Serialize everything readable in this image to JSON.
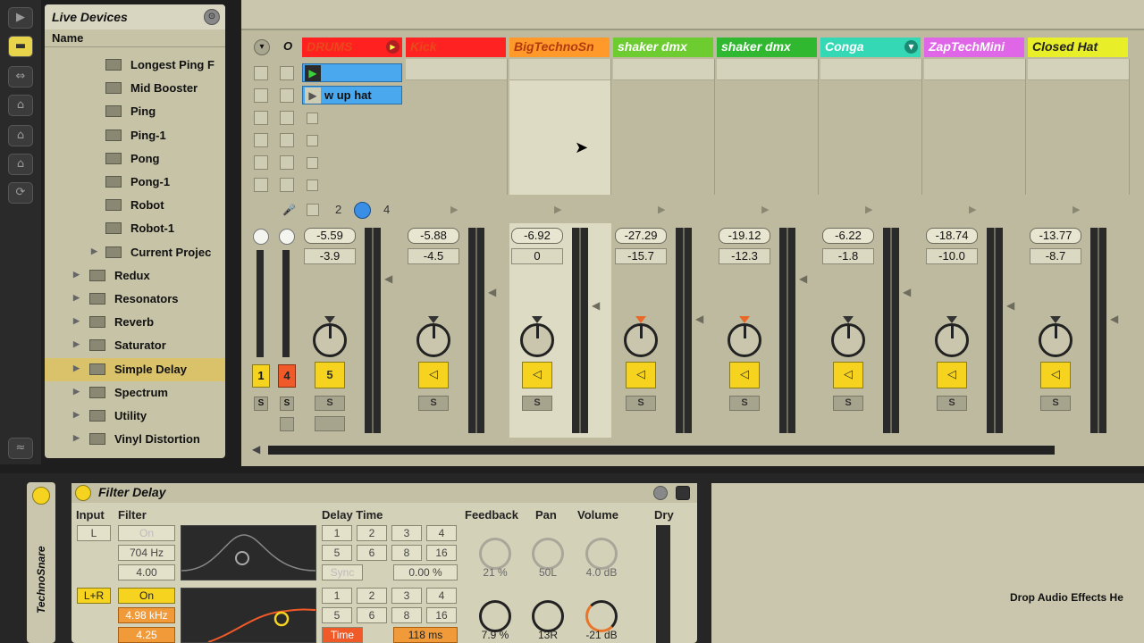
{
  "browser": {
    "title": "Live Devices",
    "hotswap_icon": "⊙",
    "column_header": "Name",
    "items": [
      {
        "label": "Longest Ping F",
        "kind": "preset"
      },
      {
        "label": "Mid Booster",
        "kind": "preset"
      },
      {
        "label": "Ping",
        "kind": "preset"
      },
      {
        "label": "Ping-1",
        "kind": "preset"
      },
      {
        "label": "Pong",
        "kind": "preset"
      },
      {
        "label": "Pong-1",
        "kind": "preset"
      },
      {
        "label": "Robot",
        "kind": "preset"
      },
      {
        "label": "Robot-1",
        "kind": "preset"
      },
      {
        "label": "Current Projec",
        "kind": "subfolder"
      },
      {
        "label": "Redux",
        "kind": "folder"
      },
      {
        "label": "Resonators",
        "kind": "folder"
      },
      {
        "label": "Reverb",
        "kind": "folder"
      },
      {
        "label": "Saturator",
        "kind": "folder"
      },
      {
        "label": "Simple Delay",
        "kind": "folder",
        "selected": true
      },
      {
        "label": "Spectrum",
        "kind": "folder"
      },
      {
        "label": "Utility",
        "kind": "folder"
      },
      {
        "label": "Vinyl Distortion",
        "kind": "folder"
      }
    ]
  },
  "session": {
    "header_buttons": {
      "fold": "▾",
      "overdub": "O"
    },
    "tracks": [
      {
        "name": "DRUMS",
        "color": "#ff2020",
        "text_color": "#e84a1a",
        "volume": "-5.59",
        "pan": "-3.9",
        "knob_mark": "dark",
        "button": "5"
      },
      {
        "name": "Kick",
        "color": "#ff2222",
        "text_color": "#e84a1a",
        "volume": "-5.88",
        "pan": "-4.5",
        "knob_mark": "dark",
        "button": "◁"
      },
      {
        "name": "BigTechnoSn",
        "color": "#ff9a2a",
        "text_color": "#b33a10",
        "volume": "-6.92",
        "pan": "0",
        "knob_mark": "dark",
        "button": "◁"
      },
      {
        "name": "shaker dmx",
        "color": "#6ccc30",
        "text_color": "#ffffff",
        "volume": "-27.29",
        "pan": "-15.7",
        "knob_mark": "red",
        "button": "◁"
      },
      {
        "name": "shaker dmx",
        "color": "#30b830",
        "text_color": "#ffffff",
        "volume": "-19.12",
        "pan": "-12.3",
        "knob_mark": "red",
        "button": "◁"
      },
      {
        "name": "Conga",
        "color": "#34d8b4",
        "text_color": "#ffffff",
        "volume": "-6.22",
        "pan": "-1.8",
        "knob_mark": "dark",
        "button": "◁"
      },
      {
        "name": "ZapTechMini",
        "color": "#e066e8",
        "text_color": "#ffffff",
        "volume": "-18.74",
        "pan": "-10.0",
        "knob_mark": "dark",
        "button": "◁"
      },
      {
        "name": "Closed Hat",
        "color": "#e8ee28",
        "text_color": "#222222",
        "volume": "-13.77",
        "pan": "-8.7",
        "knob_mark": "dark",
        "button": "◁"
      }
    ],
    "clips": [
      {
        "label": "",
        "playing": true
      },
      {
        "label": "w up hat",
        "playing": false
      }
    ],
    "group_controls": {
      "left_num": "2",
      "right_num": "4"
    },
    "track_buttons": {
      "first": "1",
      "second": "4",
      "solo": "S"
    }
  },
  "device": {
    "rack_label": "TechnoSnare",
    "title": "Filter Delay",
    "sections": {
      "input": "Input",
      "filter": "Filter",
      "delay_time": "Delay Time",
      "feedback": "Feedback",
      "pan": "Pan",
      "volume": "Volume",
      "dry": "Dry"
    },
    "lane1": {
      "input": "L",
      "on": "On",
      "freq": "704 Hz",
      "width": "4.00",
      "on_state": false
    },
    "lane2": {
      "input": "L+R",
      "on": "On",
      "freq": "4.98 kHz",
      "width": "4.25",
      "on_state": true
    },
    "sync_buttons_1": [
      "1",
      "2",
      "3",
      "4",
      "5",
      "6",
      "8",
      "16"
    ],
    "sync_label": "Sync",
    "offset_1": "0.00 %",
    "sync_buttons_2": [
      "1",
      "2",
      "3",
      "4",
      "5",
      "6",
      "8",
      "16"
    ],
    "time_label": "Time",
    "time_value": "118 ms",
    "row1": {
      "feedback": "21 %",
      "pan": "50L",
      "volume": "4.0 dB"
    },
    "row2": {
      "feedback": "7.9 %",
      "pan": "13R",
      "volume": "-21 dB"
    }
  },
  "drop_zone": {
    "text": "Drop Audio Effects He"
  },
  "colors": {
    "accent": "#f5d31e",
    "clip_blue": "#4aa8ee",
    "selection": "#d9c269"
  }
}
